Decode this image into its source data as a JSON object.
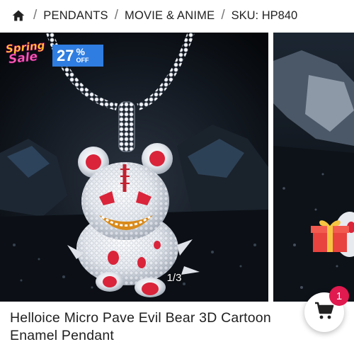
{
  "breadcrumb": {
    "home_icon": "home-icon",
    "separator": "/",
    "items": [
      "PENDANTS",
      "MOVIE & ANIME"
    ],
    "sku": "SKU: HP840"
  },
  "gallery": {
    "counter": "1/3",
    "sale_badge": {
      "word_top": "Spring",
      "word_bottom": "Sale",
      "percent": "27",
      "percent_sign": "%",
      "off": "OFF"
    },
    "gift_icon": "gift-box-icon"
  },
  "cart": {
    "icon": "shopping-cart-icon",
    "count": "1"
  },
  "product": {
    "title": "Helloice Micro Pave Evil Bear 3D Cartoon Enamel Pendant"
  },
  "colors": {
    "badge_blue": "#2f7de1",
    "cart_badge": "#e0194e",
    "enamel_red": "#d9243a"
  }
}
